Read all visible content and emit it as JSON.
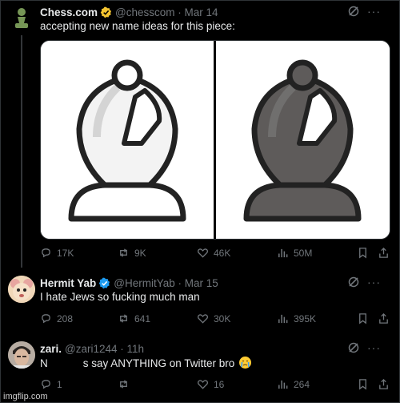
{
  "tweets": [
    {
      "name": "Chess.com",
      "handle": "@chesscom · Mar 14",
      "text": "accepting new name ideas for this piece:",
      "stats": {
        "replies": "17K",
        "reposts": "9K",
        "likes": "46K",
        "views": "50M"
      }
    },
    {
      "name": "Hermit Yab",
      "handle": "@HermitYab · Mar 15",
      "text": "I hate Jews so fucking much man",
      "stats": {
        "replies": "208",
        "reposts": "641",
        "likes": "30K",
        "views": "395K"
      }
    },
    {
      "name": "zari.",
      "handle": "@zari1244 · 11h",
      "text_start": "N",
      "text_end": "s say ANYTHING on Twitter bro",
      "stats": {
        "replies": "1",
        "reposts": "",
        "likes": "16",
        "views": "264"
      }
    }
  ],
  "watermark": "imgflip.com",
  "colors": {
    "background": "#000000",
    "muted": "#71767b",
    "text": "#e7e9ea",
    "verified": "#1d9bf0",
    "gold": "#f4c430",
    "chess_green": "#769656"
  }
}
